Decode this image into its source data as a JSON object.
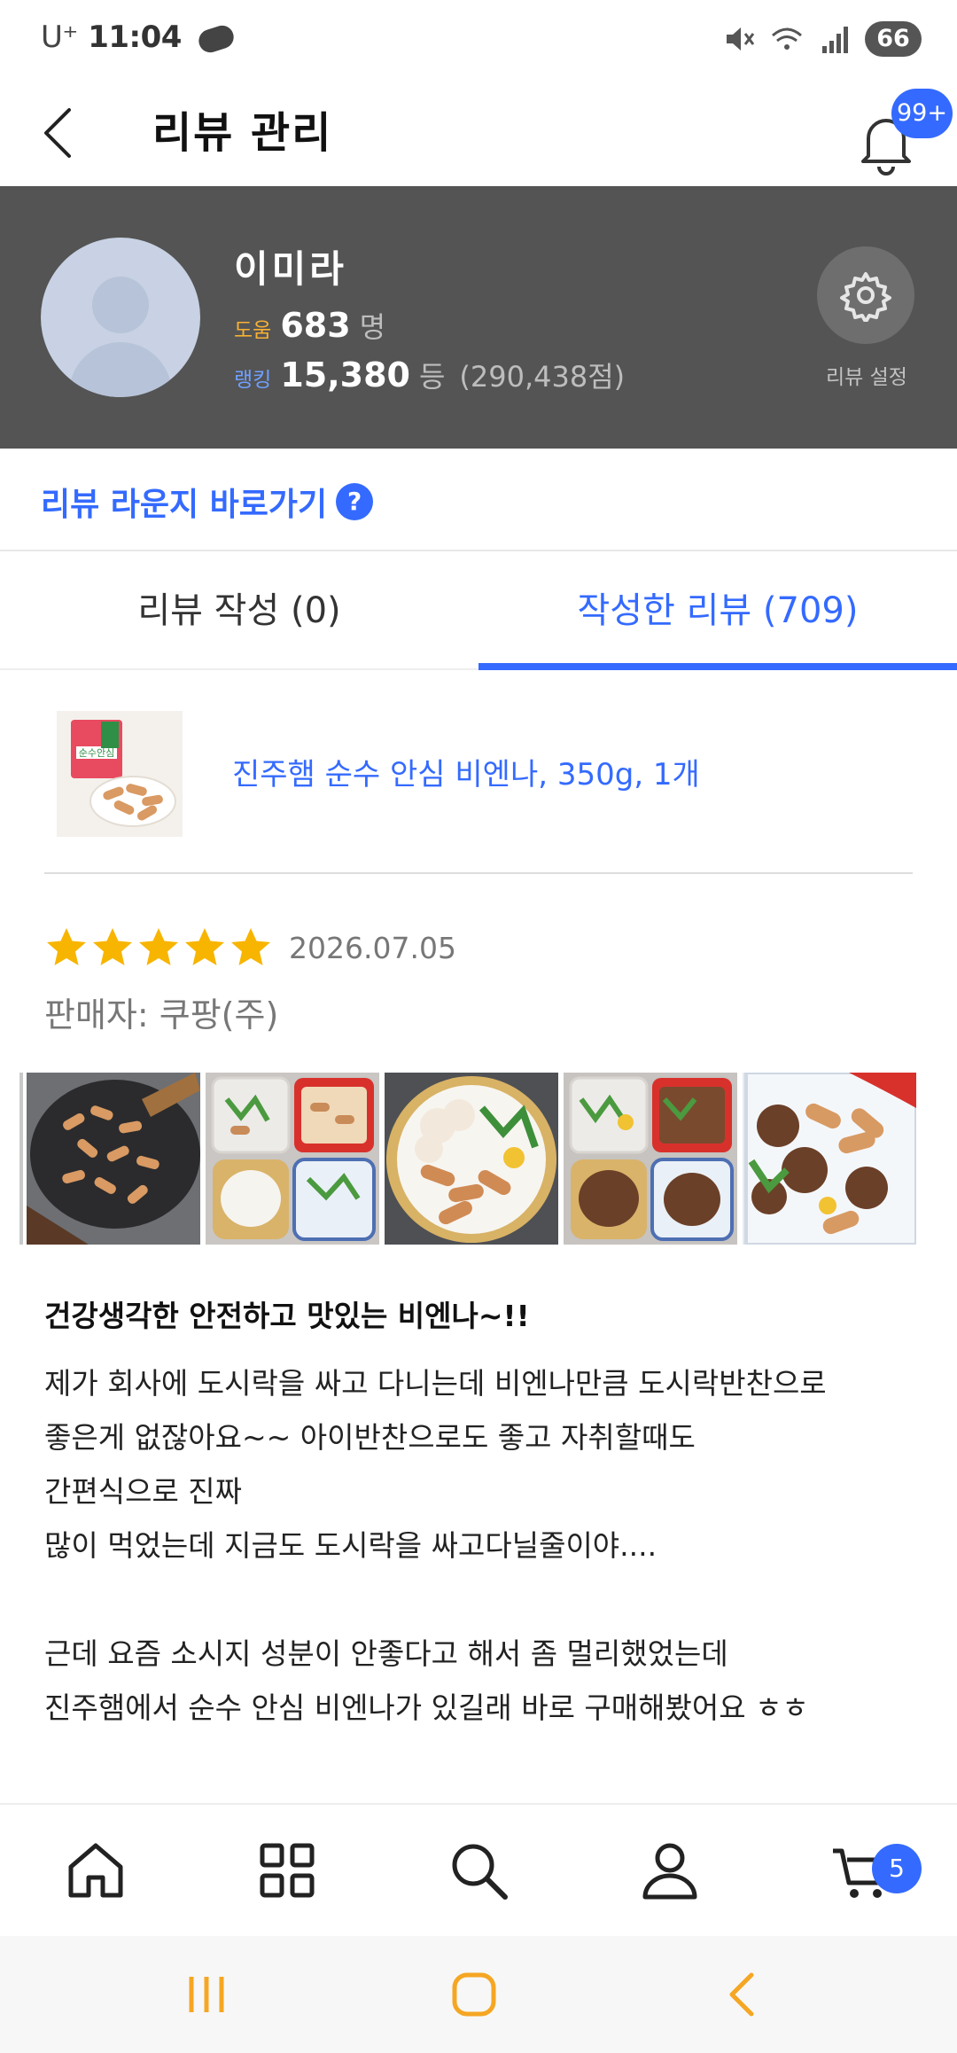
{
  "status_bar": {
    "carrier": "U⁺",
    "time": "11:04",
    "battery": "66"
  },
  "header": {
    "title": "리뷰 관리",
    "notification_badge": "99+"
  },
  "profile": {
    "name": "이미라",
    "help_label": "도움",
    "help_count": "683",
    "help_unit": "명",
    "rank_label": "랭킹",
    "rank_value": "15,380",
    "rank_unit": "등",
    "points": "(290,438점)",
    "settings_label": "리뷰 설정"
  },
  "lounge_link": {
    "label": "리뷰 라운지 바로가기",
    "help_icon_text": "?"
  },
  "tabs": [
    {
      "label": "리뷰 작성 (0)",
      "active": false
    },
    {
      "label": "작성한 리뷰 (709)",
      "active": true
    }
  ],
  "product": {
    "name": "진주햄 순수 안심 비엔나, 350g, 1개",
    "thumb_text": "순수안심"
  },
  "review": {
    "stars": 5,
    "star_color": "#f7b500",
    "date": "2026.07.05",
    "seller": "판매자: 쿠팡(주)",
    "photo_count": 5,
    "title": "건강생각한 안전하고 맛있는 비엔나~!!",
    "body_lines": [
      "제가 회사에 도시락을 싸고 다니는데 비엔나만큼 도시락반찬으로",
      "좋은게 없잖아요~~ 아이반찬으로도 좋고 자취할때도",
      "간편식으로 진짜",
      "많이 먹었는데 지금도 도시락을 싸고다닐줄이야....",
      "",
      "근데 요즘 소시지 성분이 안좋다고 해서 좀 멀리했었는데",
      "진주햄에서 순수 안심 비엔나가 있길래 바로 구매해봤어요 ㅎㅎ"
    ]
  },
  "bottom_nav": {
    "items": [
      "home-icon",
      "category-icon",
      "search-icon",
      "my-page-icon",
      "cart-icon"
    ],
    "cart_badge": "5"
  },
  "colors": {
    "accent": "#346aff",
    "profile_bg": "#545454",
    "help_label": "#f8b133",
    "system_nav": "#f5a623"
  }
}
